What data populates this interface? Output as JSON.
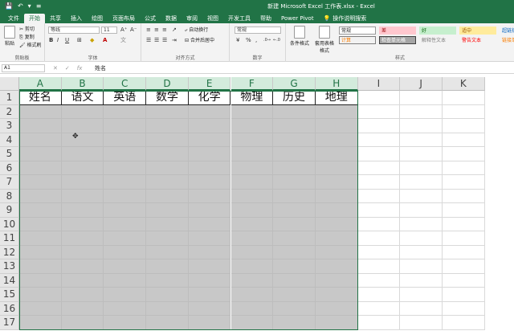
{
  "window": {
    "title": "新建 Microsoft Excel 工作表.xlsx  -  Excel"
  },
  "qat": [
    "💾",
    "↶",
    "▾",
    "≡"
  ],
  "tabs": [
    {
      "label": "文件",
      "active": false
    },
    {
      "label": "开始",
      "active": true
    },
    {
      "label": "共享",
      "active": false
    },
    {
      "label": "插入",
      "active": false
    },
    {
      "label": "绘图",
      "active": false
    },
    {
      "label": "页面布局",
      "active": false
    },
    {
      "label": "公式",
      "active": false
    },
    {
      "label": "数据",
      "active": false
    },
    {
      "label": "审阅",
      "active": false
    },
    {
      "label": "视图",
      "active": false
    },
    {
      "label": "开发工具",
      "active": false
    },
    {
      "label": "帮助",
      "active": false
    },
    {
      "label": "Power Pivot",
      "active": false
    }
  ],
  "tell_me": "操作说明搜索",
  "ribbon": {
    "clipboard": {
      "paste": "粘贴",
      "cut": "剪切",
      "copy": "复制",
      "format_painter": "格式刷",
      "label": "剪贴板"
    },
    "font": {
      "name": "等线",
      "size": "11",
      "label": "字体",
      "bold": "B",
      "italic": "I",
      "underline": "U",
      "font_color": "A"
    },
    "align": {
      "wrap": "自动换行",
      "merge": "合并后居中",
      "label": "对齐方式"
    },
    "number": {
      "format": "常规",
      "label": "数字",
      "percent": "%",
      "comma": ","
    },
    "styles": {
      "cond_format": "条件格式",
      "table_format": "套用表格格式",
      "label": "样式",
      "cells": [
        {
          "text": "常规",
          "bg": "#ffffff",
          "fg": "#222222",
          "border": "#999999"
        },
        {
          "text": "差",
          "bg": "#ffc7ce",
          "fg": "#9c0006",
          "border": "#ffc7ce"
        },
        {
          "text": "好",
          "bg": "#c6efce",
          "fg": "#006100",
          "border": "#c6efce"
        },
        {
          "text": "适中",
          "bg": "#ffeb9c",
          "fg": "#9c5700",
          "border": "#ffeb9c"
        },
        {
          "text": "超链接",
          "bg": "#f3f3f3",
          "fg": "#0563c1",
          "border": "#f3f3f3"
        },
        {
          "text": "计算",
          "bg": "#f2f2f2",
          "fg": "#fa7d00",
          "border": "#7f7f7f"
        },
        {
          "text": "检查单元格",
          "bg": "#a5a5a5",
          "fg": "#ffffff",
          "border": "#3f3f3f"
        },
        {
          "text": "解释性文本",
          "bg": "#f3f3f3",
          "fg": "#7f7f7f",
          "border": "#f3f3f3"
        },
        {
          "text": "警告文本",
          "bg": "#f3f3f3",
          "fg": "#ff0000",
          "border": "#f3f3f3"
        },
        {
          "text": "链接单",
          "bg": "#f3f3f3",
          "fg": "#fa7d00",
          "border": "#f3f3f3"
        }
      ]
    }
  },
  "formula_bar": {
    "name_box": "A1",
    "fx": "fx",
    "cancel": "✕",
    "enter": "✓",
    "value": "姓名"
  },
  "columns": [
    "A",
    "B",
    "C",
    "D",
    "E",
    "F",
    "G",
    "H",
    "I",
    "J",
    "K"
  ],
  "selected_columns": [
    "A",
    "B",
    "C",
    "D",
    "E",
    "F",
    "G",
    "H"
  ],
  "rows": [
    "1",
    "2",
    "3",
    "4",
    "5",
    "6",
    "7",
    "8",
    "9",
    "10",
    "11",
    "12",
    "13",
    "14",
    "15",
    "16",
    "17"
  ],
  "header_row": [
    "姓名",
    "语文",
    "英语",
    "数学",
    "化学",
    "物理",
    "历史",
    "地理"
  ],
  "colors": {
    "accent": "#217346",
    "selection": "#c8c8c8",
    "header_sel": "#d3ebdc"
  }
}
